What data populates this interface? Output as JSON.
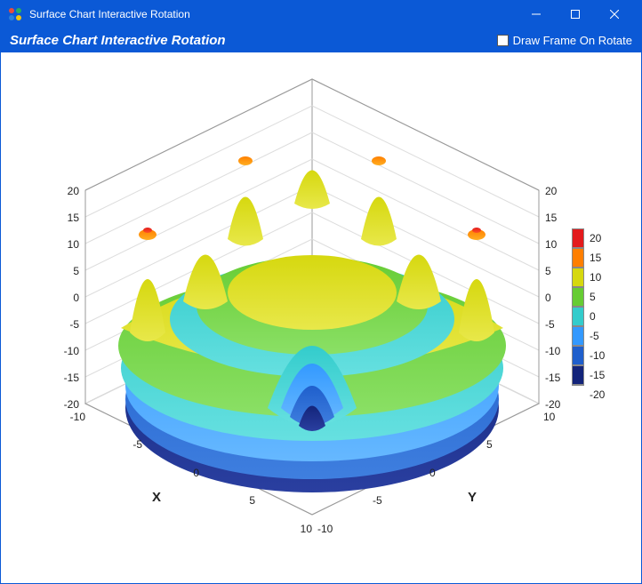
{
  "window": {
    "title": "Surface Chart Interactive Rotation"
  },
  "toolbar": {
    "title": "Surface Chart Interactive Rotation",
    "checkbox_label": "Draw Frame On Rotate",
    "checkbox_checked": false
  },
  "chart_data": {
    "type": "surface3d",
    "function": "z = f(x, y) — oscillating radial surface with multiple peaks and troughs",
    "x_range": [
      -10,
      10
    ],
    "y_range": [
      -10,
      10
    ],
    "z_range": [
      -20,
      20
    ],
    "x_label": "X",
    "y_label": "Y",
    "z_label": "",
    "x_ticks": [
      -10,
      -5,
      0,
      5,
      10
    ],
    "y_ticks": [
      -10,
      -5,
      0,
      5,
      10
    ],
    "z_ticks": [
      -20,
      -15,
      -10,
      -5,
      0,
      5,
      10,
      15,
      20
    ],
    "color_scale": {
      "type": "banded",
      "bands": [
        {
          "from": 15,
          "to": 20,
          "color": "#e31a1c"
        },
        {
          "from": 10,
          "to": 15,
          "color": "#ff7f00"
        },
        {
          "from": 5,
          "to": 10,
          "color": "#d6d80f"
        },
        {
          "from": 0,
          "to": 5,
          "color": "#66cc33"
        },
        {
          "from": -5,
          "to": 0,
          "color": "#33cccc"
        },
        {
          "from": -10,
          "to": -5,
          "color": "#3399ff"
        },
        {
          "from": -15,
          "to": -10,
          "color": "#1f5fcc"
        },
        {
          "from": -20,
          "to": -15,
          "color": "#13247a"
        }
      ],
      "legend_ticks": [
        20,
        15,
        10,
        5,
        0,
        -5,
        -10,
        -15,
        -20
      ]
    },
    "view": {
      "rotation_interactive": true
    }
  },
  "axis": {
    "x": {
      "label": "X",
      "t_m10": "-10",
      "t_m5": "-5",
      "t_0": "0",
      "t_5": "5",
      "t_10": "10"
    },
    "y": {
      "label": "Y",
      "t_m10": "-10",
      "t_m5": "-5",
      "t_0": "0",
      "t_5": "5",
      "t_10": "10"
    },
    "zl": {
      "t_m20": "-20",
      "t_m15": "-15",
      "t_m10": "-10",
      "t_m5": "-5",
      "t_0": "0",
      "t_5": "5",
      "t_10": "10",
      "t_15": "15",
      "t_20": "20"
    },
    "zr": {
      "t_m20": "-20",
      "t_m15": "-15",
      "t_m10": "-10",
      "t_m5": "-5",
      "t_0": "0",
      "t_5": "5",
      "t_10": "10",
      "t_15": "15",
      "t_20": "20"
    }
  },
  "legend": {
    "t20": "20",
    "t15": "15",
    "t10": "10",
    "t5": "5",
    "t0": "0",
    "tm5": "-5",
    "tm10": "-10",
    "tm15": "-15",
    "tm20": "-20"
  }
}
